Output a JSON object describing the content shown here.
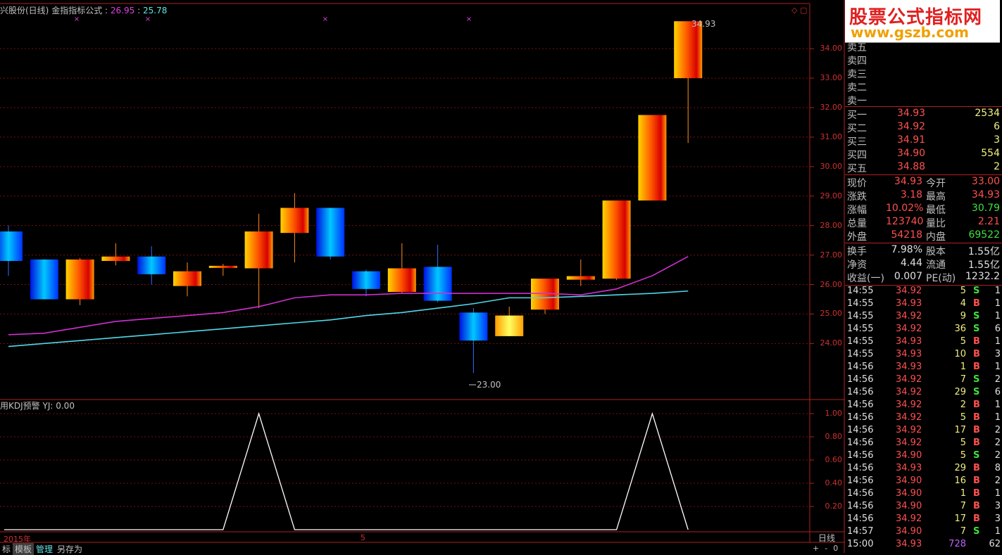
{
  "header": {
    "stock": "兴股份(日线)",
    "indicator": "金指指标公式",
    "v1_label": ":",
    "v1": "26.95",
    "v2_label": ":",
    "v2": "25.78"
  },
  "kdj_header": {
    "name": "用KDJ预警",
    "label": "YJ:",
    "value": "0.00"
  },
  "price_axis_labels": [
    "34.00",
    "33.00",
    "32.00",
    "31.00",
    "30.00",
    "29.00",
    "28.00",
    "27.00",
    "26.00",
    "25.00",
    "24.00"
  ],
  "kdj_axis_labels": [
    "1.00",
    "0.80",
    "0.60",
    "0.40",
    "0.20"
  ],
  "annotations": {
    "high": "34.93",
    "low": "23.00"
  },
  "x_labels": {
    "year": "2015年",
    "month": "5"
  },
  "period_label": "日线",
  "bottom_buttons": [
    "标",
    "模板",
    "管理",
    "另存为"
  ],
  "corner_buttons": [
    "+",
    "-",
    "0"
  ],
  "logo": {
    "line1": "股票公式指标网",
    "line2": "www.gszb.com"
  },
  "chart_data": {
    "type": "candlestick",
    "ylim": [
      23.0,
      35.2
    ],
    "candles": [
      {
        "o": 26.8,
        "h": 28.0,
        "l": 26.3,
        "c": 27.8,
        "dir": "down"
      },
      {
        "o": 26.85,
        "h": 26.85,
        "l": 25.5,
        "c": 25.5,
        "dir": "down"
      },
      {
        "o": 25.5,
        "h": 26.9,
        "l": 25.3,
        "c": 26.85,
        "dir": "up"
      },
      {
        "o": 26.8,
        "h": 27.4,
        "l": 26.65,
        "c": 26.95,
        "dir": "up"
      },
      {
        "o": 26.95,
        "h": 27.3,
        "l": 26.0,
        "c": 26.35,
        "dir": "down"
      },
      {
        "o": 25.95,
        "h": 26.75,
        "l": 25.6,
        "c": 26.45,
        "dir": "up"
      },
      {
        "o": 26.6,
        "h": 26.7,
        "l": 26.3,
        "c": 26.6,
        "dir": "up"
      },
      {
        "o": 26.55,
        "h": 28.4,
        "l": 25.2,
        "c": 27.8,
        "dir": "up"
      },
      {
        "o": 27.75,
        "h": 29.1,
        "l": 26.75,
        "c": 28.6,
        "dir": "up"
      },
      {
        "o": 28.6,
        "h": 28.6,
        "l": 26.85,
        "c": 26.95,
        "dir": "down"
      },
      {
        "o": 26.45,
        "h": 26.5,
        "l": 25.6,
        "c": 25.85,
        "dir": "down"
      },
      {
        "o": 25.75,
        "h": 27.4,
        "l": 25.7,
        "c": 26.55,
        "dir": "up"
      },
      {
        "o": 26.6,
        "h": 27.35,
        "l": 25.4,
        "c": 25.45,
        "dir": "down"
      },
      {
        "o": 25.05,
        "h": 25.2,
        "l": 23.0,
        "c": 24.1,
        "dir": "down"
      },
      {
        "o": 24.25,
        "h": 25.25,
        "l": 24.25,
        "c": 24.95,
        "dir": "up-yellow"
      },
      {
        "o": 25.15,
        "h": 26.2,
        "l": 25.0,
        "c": 26.2,
        "dir": "up"
      },
      {
        "o": 26.2,
        "h": 26.85,
        "l": 25.95,
        "c": 26.25,
        "dir": "up"
      },
      {
        "o": 26.2,
        "h": 28.85,
        "l": 26.15,
        "c": 28.85,
        "dir": "up"
      },
      {
        "o": 28.85,
        "h": 31.75,
        "l": 28.85,
        "c": 31.75,
        "dir": "up"
      },
      {
        "o": 33.0,
        "h": 34.93,
        "l": 30.8,
        "c": 34.93,
        "dir": "up"
      }
    ],
    "ma_fast": [
      24.3,
      24.35,
      24.55,
      24.75,
      24.85,
      24.95,
      25.05,
      25.25,
      25.55,
      25.65,
      25.65,
      25.7,
      25.7,
      25.7,
      25.7,
      25.7,
      25.65,
      25.85,
      26.3,
      26.95
    ],
    "ma_slow": [
      23.9,
      24.0,
      24.1,
      24.2,
      24.3,
      24.4,
      24.5,
      24.6,
      24.7,
      24.8,
      24.95,
      25.05,
      25.2,
      25.35,
      25.55,
      25.55,
      25.6,
      25.65,
      25.7,
      25.78
    ],
    "kdj_yj": [
      0,
      0,
      0,
      0,
      0,
      0,
      0,
      1,
      0,
      0,
      0,
      0,
      0,
      0,
      0,
      0,
      0,
      0,
      1,
      0
    ],
    "kdj_ylim": [
      0,
      1.0
    ]
  },
  "sidebar": {
    "sell_labels": [
      "卖五",
      "卖四",
      "卖三",
      "卖二",
      "卖一"
    ],
    "buy": [
      {
        "label": "买一",
        "price": "34.93",
        "vol": "2534"
      },
      {
        "label": "买二",
        "price": "34.92",
        "vol": "6"
      },
      {
        "label": "买三",
        "price": "34.91",
        "vol": "3"
      },
      {
        "label": "买四",
        "price": "34.90",
        "vol": "554"
      },
      {
        "label": "买五",
        "price": "34.88",
        "vol": "2"
      }
    ],
    "quote": [
      {
        "l1": "现价",
        "v1": "34.93",
        "l2": "今开",
        "v2": "33.00"
      },
      {
        "l1": "涨跌",
        "v1": "3.18",
        "l2": "最高",
        "v2": "34.93"
      },
      {
        "l1": "涨幅",
        "v1": "10.02%",
        "l2": "最低",
        "v2": "30.79"
      },
      {
        "l1": "总量",
        "v1": "123740",
        "l2": "量比",
        "v2": "2.21"
      },
      {
        "l1": "外盘",
        "v1": "54218",
        "l2": "内盘",
        "v2": "69522"
      }
    ],
    "info": [
      {
        "l1": "换手",
        "v1": "7.98%",
        "l2": "股本",
        "v2": "1.55亿"
      },
      {
        "l1": "净资",
        "v1": "4.44",
        "l2": "流通",
        "v2": "1.55亿"
      },
      {
        "l1": "收益(一)",
        "v1": "0.007",
        "l2": "PE(动)",
        "v2": "1232.2"
      }
    ],
    "ticks": [
      {
        "t": "14:55",
        "p": "34.92",
        "v": "5",
        "s": "S",
        "n": "1"
      },
      {
        "t": "14:55",
        "p": "34.93",
        "v": "4",
        "s": "B",
        "n": "1"
      },
      {
        "t": "14:55",
        "p": "34.92",
        "v": "9",
        "s": "S",
        "n": "1"
      },
      {
        "t": "14:55",
        "p": "34.92",
        "v": "36",
        "s": "S",
        "n": "6"
      },
      {
        "t": "14:55",
        "p": "34.93",
        "v": "5",
        "s": "B",
        "n": "1"
      },
      {
        "t": "14:55",
        "p": "34.93",
        "v": "10",
        "s": "B",
        "n": "3"
      },
      {
        "t": "14:56",
        "p": "34.93",
        "v": "1",
        "s": "B",
        "n": "1"
      },
      {
        "t": "14:56",
        "p": "34.92",
        "v": "7",
        "s": "S",
        "n": "2"
      },
      {
        "t": "14:56",
        "p": "34.92",
        "v": "29",
        "s": "S",
        "n": "6"
      },
      {
        "t": "14:56",
        "p": "34.92",
        "v": "2",
        "s": "B",
        "n": "1"
      },
      {
        "t": "14:56",
        "p": "34.92",
        "v": "5",
        "s": "B",
        "n": "1"
      },
      {
        "t": "14:56",
        "p": "34.92",
        "v": "17",
        "s": "B",
        "n": "2"
      },
      {
        "t": "14:56",
        "p": "34.92",
        "v": "5",
        "s": "B",
        "n": "2"
      },
      {
        "t": "14:56",
        "p": "34.90",
        "v": "5",
        "s": "S",
        "n": "2"
      },
      {
        "t": "14:56",
        "p": "34.93",
        "v": "29",
        "s": "B",
        "n": "8"
      },
      {
        "t": "14:56",
        "p": "34.90",
        "v": "16",
        "s": "B",
        "n": "2"
      },
      {
        "t": "14:56",
        "p": "34.90",
        "v": "1",
        "s": "B",
        "n": "1"
      },
      {
        "t": "14:56",
        "p": "34.90",
        "v": "7",
        "s": "B",
        "n": "3"
      },
      {
        "t": "14:56",
        "p": "34.92",
        "v": "17",
        "s": "B",
        "n": "3"
      },
      {
        "t": "14:57",
        "p": "34.90",
        "v": "7",
        "s": "S",
        "n": "1"
      },
      {
        "t": "15:00",
        "p": "34.93",
        "v": "728",
        "s": "",
        "n": "62"
      }
    ]
  }
}
